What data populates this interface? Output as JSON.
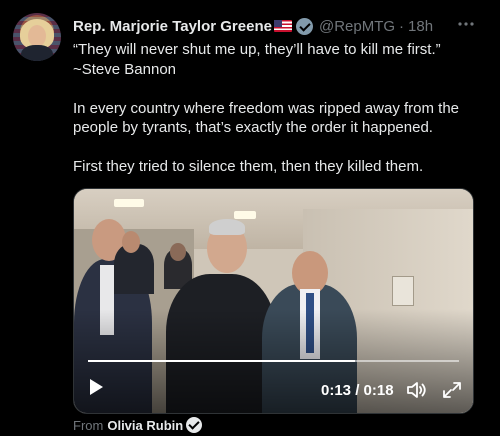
{
  "tweet": {
    "author_name": "Rep. Marjorie Taylor Greene",
    "author_handle": "@RepMTG",
    "separator": "·",
    "time": "18h",
    "more_icon": "more-horizontal-icon",
    "text": {
      "line1": "“They will never shut me up, they’ll have to kill me first.”",
      "line2": "~Steve Bannon",
      "line3": "In every country where freedom was ripped away from the",
      "line4": "people by tyrants, that’s exactly the order it happened.",
      "line5": "First they tried to silence them, then they killed them."
    },
    "video": {
      "timecode": "0:13 / 0:18",
      "progress": 0.72,
      "play_icon": "play-icon",
      "volume_icon": "volume-icon",
      "expand_icon": "expand-icon"
    },
    "attribution": {
      "prefix": "From",
      "name": "Olivia Rubin"
    }
  },
  "colors": {
    "background": "#000000",
    "text_primary": "#e7e9ea",
    "text_secondary": "#71767b",
    "government_badge": "#829aab"
  }
}
